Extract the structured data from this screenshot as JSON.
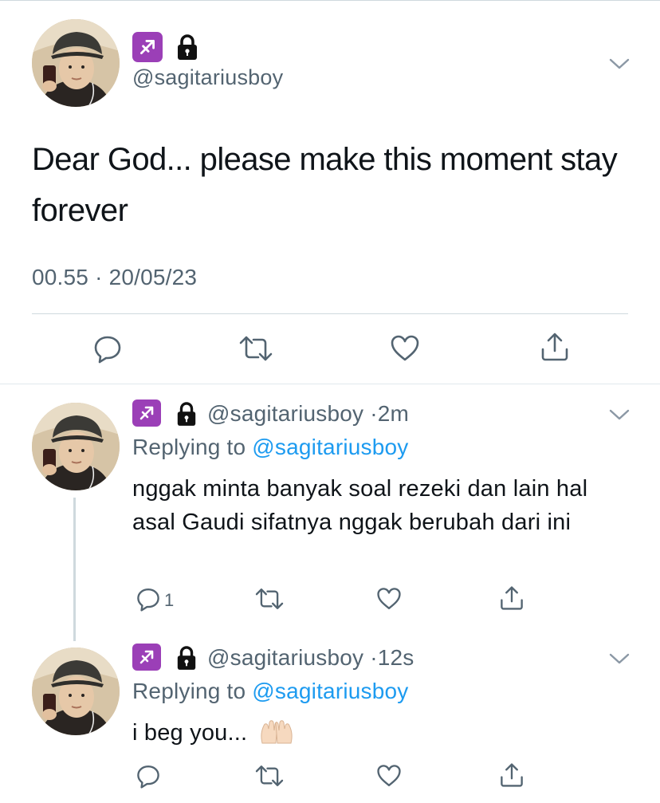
{
  "main_tweet": {
    "handle": "@sagitariusboy",
    "sign_icon": "sagittarius-icon",
    "lock_icon": "lock-icon",
    "text": "Dear God... please make this moment stay forever",
    "time": "00.55",
    "dot": "·",
    "date": "20/05/23"
  },
  "replies": [
    {
      "handle": "@sagitariusboy",
      "dot": "·",
      "age": "2m",
      "replying_prefix": "Replying to",
      "replying_to": "@sagitariusboy",
      "text": "nggak minta banyak soal rezeki dan lain hal asal Gaudi sifatnya nggak berubah dari ini",
      "reply_count": "1"
    },
    {
      "handle": "@sagitariusboy",
      "dot": "·",
      "age": "12s",
      "replying_prefix": "Replying to",
      "replying_to": "@sagitariusboy",
      "text": "i beg you...",
      "emoji": "raised-hands-emoji"
    }
  ],
  "colors": {
    "accent": "#1d9bf0",
    "secondary_text": "#536471",
    "sagittarius_badge": "#9b3fb7",
    "divider": "#cfd9de"
  }
}
